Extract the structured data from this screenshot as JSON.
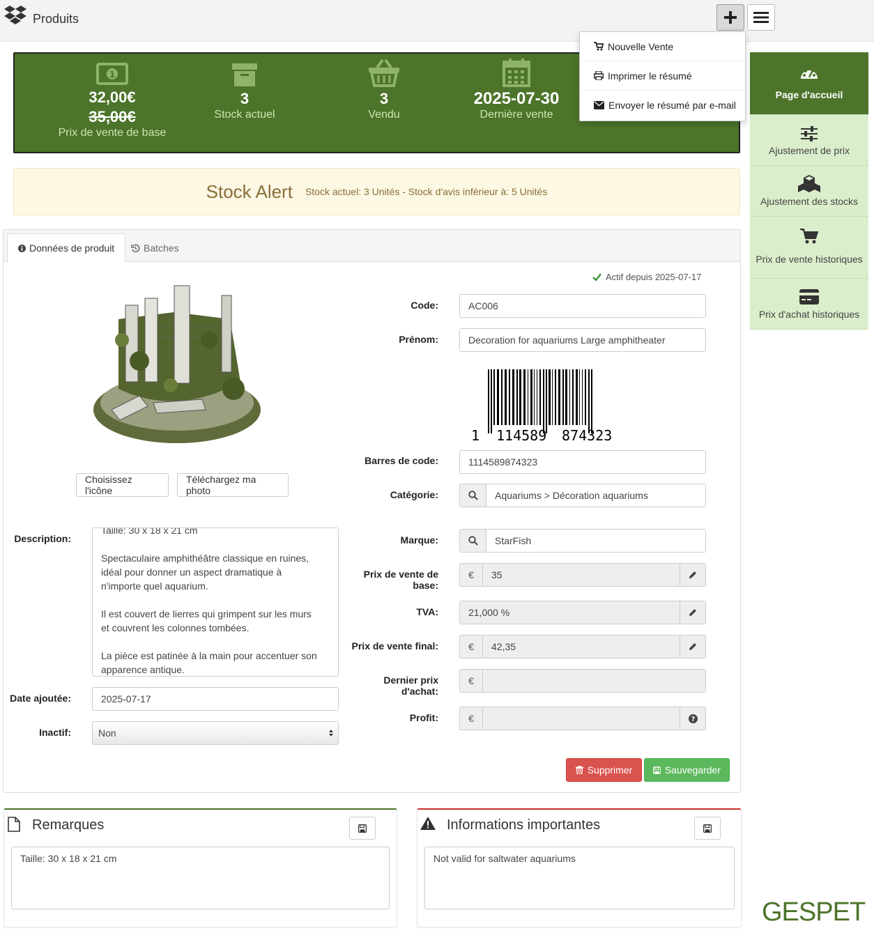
{
  "header": {
    "title": "Produits"
  },
  "dropdown": {
    "items": [
      "Nouvelle Vente",
      "Imprimer le résumé",
      "Envoyer le résumé par e-mail"
    ]
  },
  "stats": {
    "price": "32,00€",
    "old_price": "35,00€",
    "price_label": "Prix de vente de base",
    "stock": "3",
    "stock_label": "Stock actuel",
    "sold": "3",
    "sold_label": "Vendu",
    "last_sale": "2025-07-30",
    "last_sale_label": "Dernière vente"
  },
  "sidebar": {
    "items": [
      "Page d'accueil",
      "Ajustement de prix",
      "Ajustement des stocks",
      "Prix de vente historiques",
      "Prix d'achat historiques"
    ]
  },
  "alert": {
    "title": "Stock Alert",
    "detail": "Stock actuel: 3 Unités  -  Stock d'avis inférieur à: 5 Unités"
  },
  "tabs": [
    "Données de produit",
    "Batches"
  ],
  "form": {
    "active_since": "Actif depuis 2025-07-17",
    "code_label": "Code:",
    "code": "AC006",
    "name_label": "Prénom:",
    "name": "Decoration for aquariums Large amphitheater",
    "barcode_digits": [
      "1",
      "114589",
      "874323"
    ],
    "barcode_label": "Barres de code:",
    "barcode": "1114589874323",
    "category_label": "Catégorie:",
    "category": "Aquariums  > Décoration aquariums",
    "brand_label": "Marque:",
    "brand": "StarFish",
    "base_price_label": "Prix de vente de base:",
    "base_price": "35",
    "vat_label": "TVA:",
    "vat": "21,000 %",
    "final_price_label": "Prix de vente final:",
    "final_price": "42,35",
    "last_purchase_label": "Dernier prix d'achat:",
    "last_purchase": "",
    "profit_label": "Profit:",
    "profit": "",
    "currency": "€",
    "choose_icon": "Choisissez l'icône",
    "upload_photo": "Téléchargez ma photo",
    "description_label": "Description:",
    "description_lines": [
      "Taille: 30 x 18 x 21 cm",
      "",
      "Spectaculaire amphithéâtre classique en ruines,",
      "idéal pour donner un aspect dramatique à",
      "n'importe quel aquarium.",
      "",
      "Il est couvert de lierres qui grimpent sur les murs",
      "et couvrent les colonnes tombées.",
      "",
      "La pièce est patinée à la main pour accentuer son",
      "apparence antique."
    ],
    "date_label": "Date ajoutée:",
    "date": "2025-07-17",
    "inactive_label": "Inactif:",
    "inactive": "Non",
    "delete": "Supprimer",
    "save": "Sauvegarder"
  },
  "remarks": {
    "title": "Remarques",
    "text": "Taille: 30 x 18 x 21 cm"
  },
  "important": {
    "title": "Informations importantes",
    "text": "Not valid for saltwater aquariums"
  },
  "brand_logo": "GESPET",
  "colors": {
    "primary_green": "#4c742a",
    "sidebar_light": "#dbeecb",
    "danger": "#d9534f",
    "success": "#5cb85c",
    "alert_bg": "#fcf8e3"
  }
}
